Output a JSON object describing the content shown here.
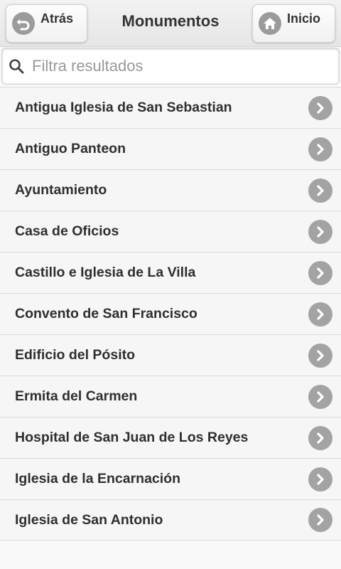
{
  "header": {
    "title": "Monumentos",
    "back_label": "Atrás",
    "home_label": "Inicio"
  },
  "search": {
    "placeholder": "Filtra resultados",
    "value": ""
  },
  "list": {
    "items": [
      {
        "label": "Antigua Iglesia de San Sebastian"
      },
      {
        "label": "Antiguo Panteon"
      },
      {
        "label": "Ayuntamiento"
      },
      {
        "label": "Casa de Oficios"
      },
      {
        "label": "Castillo e Iglesia de La Villa"
      },
      {
        "label": "Convento de San Francisco"
      },
      {
        "label": "Edificio del Pósito"
      },
      {
        "label": "Ermita del Carmen"
      },
      {
        "label": "Hospital de San Juan de Los Reyes"
      },
      {
        "label": "Iglesia de la Encarnación"
      },
      {
        "label": "Iglesia de San Antonio"
      }
    ]
  },
  "colors": {
    "icon_bg": "#9b9b9b",
    "text": "#333333",
    "list_bg": "#f6f6f6"
  }
}
